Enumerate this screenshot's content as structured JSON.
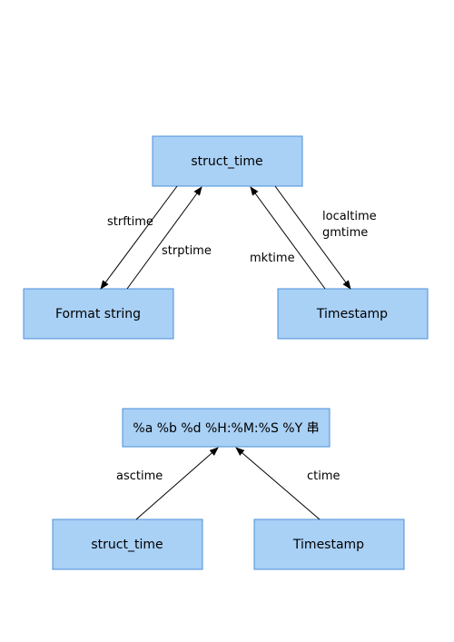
{
  "chart_data": [
    {
      "type": "diagram",
      "nodes": [
        {
          "id": "struct_time_top",
          "label": "struct_time"
        },
        {
          "id": "format_string",
          "label": "Format string"
        },
        {
          "id": "timestamp_top",
          "label": "Timestamp"
        }
      ],
      "edges": [
        {
          "from": "struct_time_top",
          "to": "format_string",
          "label": "strftime"
        },
        {
          "from": "format_string",
          "to": "struct_time_top",
          "label": "strptime"
        },
        {
          "from": "struct_time_top",
          "to": "timestamp_top",
          "label": "mktime"
        },
        {
          "from": "timestamp_top",
          "to": "struct_time_top",
          "label": "localtime"
        },
        {
          "from": "timestamp_top",
          "to": "struct_time_top",
          "label": "gmtime"
        }
      ]
    },
    {
      "type": "diagram",
      "nodes": [
        {
          "id": "format_output",
          "label": "%a %b %d %H:%M:%S %Y 串"
        },
        {
          "id": "struct_time_bot",
          "label": "struct_time"
        },
        {
          "id": "timestamp_bot",
          "label": "Timestamp"
        }
      ],
      "edges": [
        {
          "from": "struct_time_bot",
          "to": "format_output",
          "label": "asctime"
        },
        {
          "from": "timestamp_bot",
          "to": "format_output",
          "label": "ctime"
        }
      ]
    }
  ],
  "nodes": {
    "struct_time_top": "struct_time",
    "format_string": "Format string",
    "timestamp_top": "Timestamp",
    "format_output": "%a %b %d %H:%M:%S %Y 串",
    "struct_time_bot": "struct_time",
    "timestamp_bot": "Timestamp"
  },
  "edges": {
    "strftime": "strftime",
    "strptime": "strptime",
    "mktime": "mktime",
    "localtime": "localtime",
    "gmtime": "gmtime",
    "asctime": "asctime",
    "ctime": "ctime"
  }
}
